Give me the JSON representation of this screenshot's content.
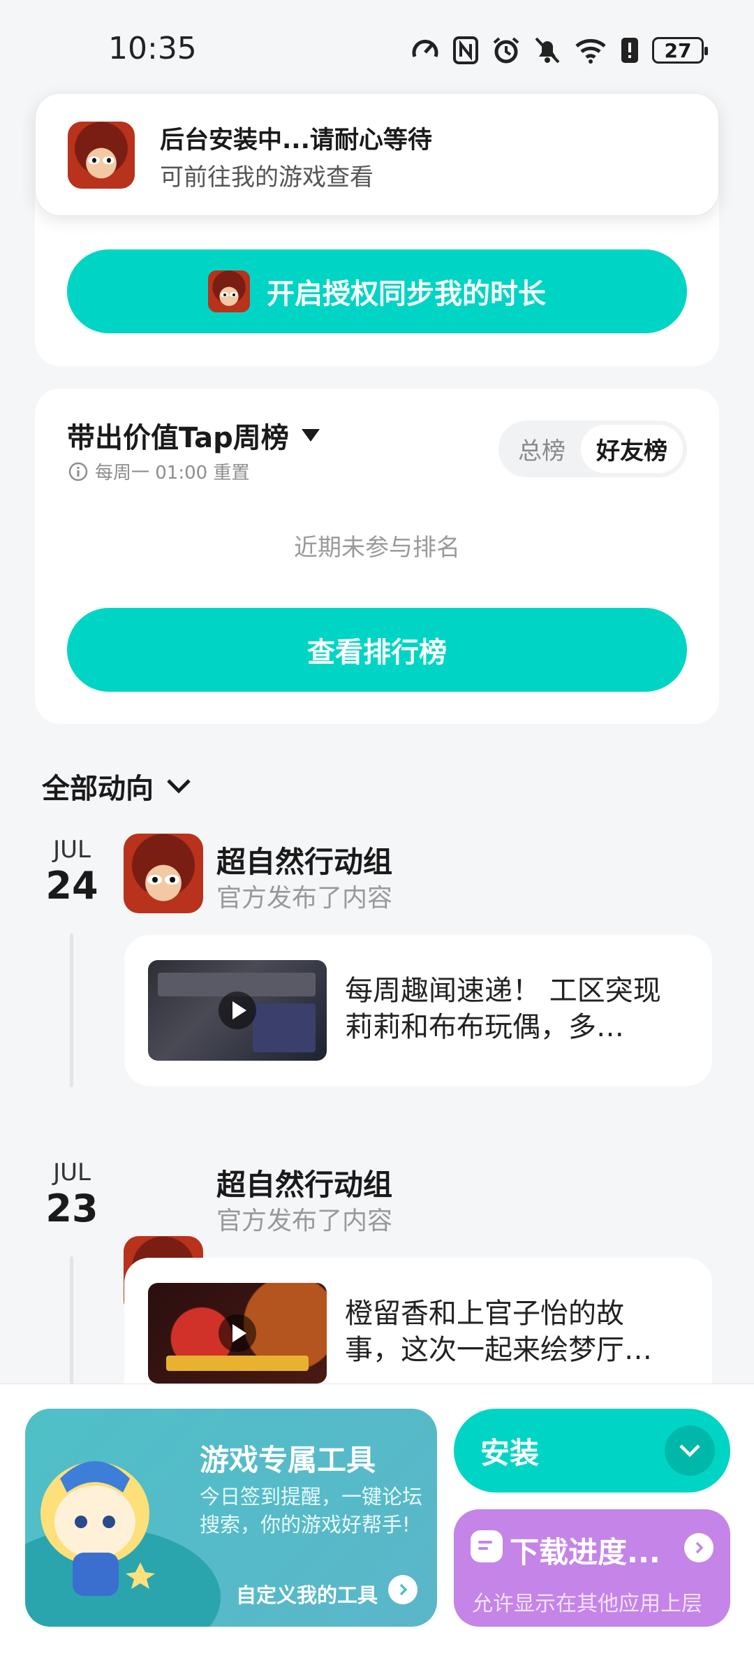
{
  "status_bar": {
    "time": "10:35",
    "battery": "27"
  },
  "toast": {
    "title": "后台安装中...请耐心等待",
    "subtitle": "可前往我的游戏查看"
  },
  "sync_card": {
    "button_label": "开启授权同步我的时长"
  },
  "ranking_card": {
    "title": "带出价值Tap周榜",
    "reset_note": "每周一 01:00 重置",
    "tabs": [
      "总榜",
      "好友榜"
    ],
    "selected_tab": "好友榜",
    "empty_text": "近期未参与排名",
    "view_button": "查看排行榜"
  },
  "feed": {
    "filter_label": "全部动向",
    "items": [
      {
        "month": "JUL",
        "day": "24",
        "author": "超自然行动组",
        "action": "官方发布了内容",
        "text": "每周趣闻速递！ 工区突现莉莉和布布玩偶，多…"
      },
      {
        "month": "JUL",
        "day": "23",
        "author": "超自然行动组",
        "action": "官方发布了内容",
        "text": "橙留香和上官子怡的故事，这次一起来绘梦厅…"
      }
    ]
  },
  "bottom": {
    "tool_card": {
      "title": "游戏专属工具",
      "desc": "今日签到提醒，一键论坛搜索，你的游戏好帮手!",
      "link": "自定义我的工具"
    },
    "install_label": "安装",
    "download": {
      "title": "下载进度...",
      "subtitle": "允许显示在其他应用上层"
    }
  },
  "colors": {
    "accent": "#00d5c5",
    "download_purple": "#c484e8",
    "tool_teal": "#4fc0c7"
  }
}
